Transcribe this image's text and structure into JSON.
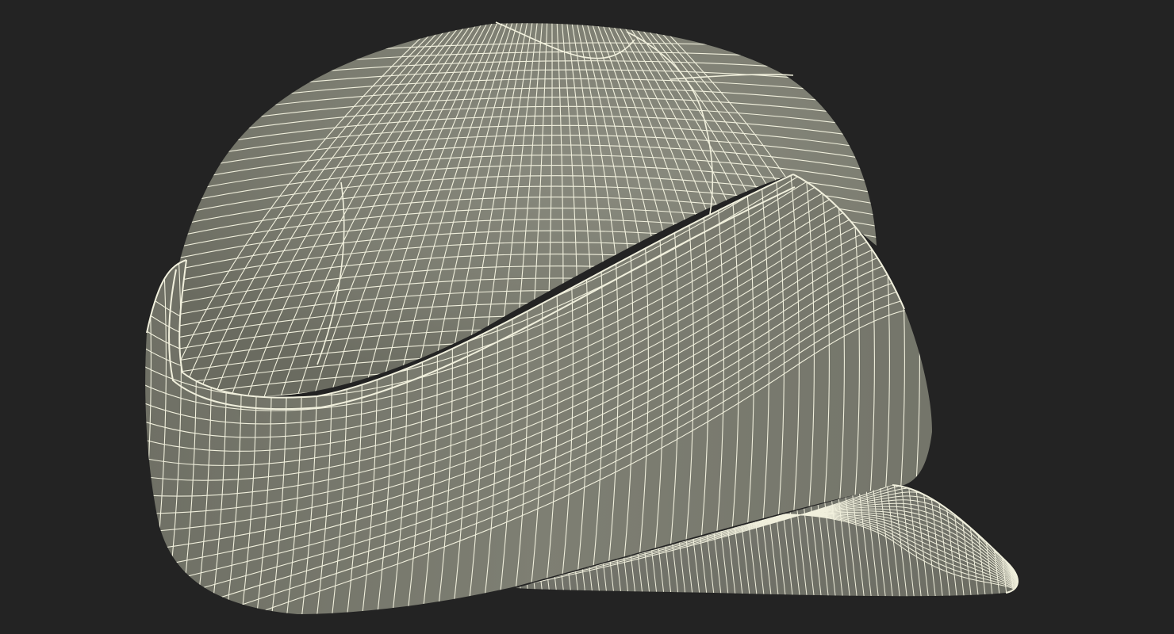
{
  "viewport": {
    "background_color": "#232323"
  },
  "model": {
    "subject": "cap-with-visor-wireframe",
    "surface_color": "#7c7d71",
    "surface_shadow_color": "#6a6b60",
    "surface_highlight_color": "#8a8b7f",
    "wire_color": "#f1f0dd"
  }
}
